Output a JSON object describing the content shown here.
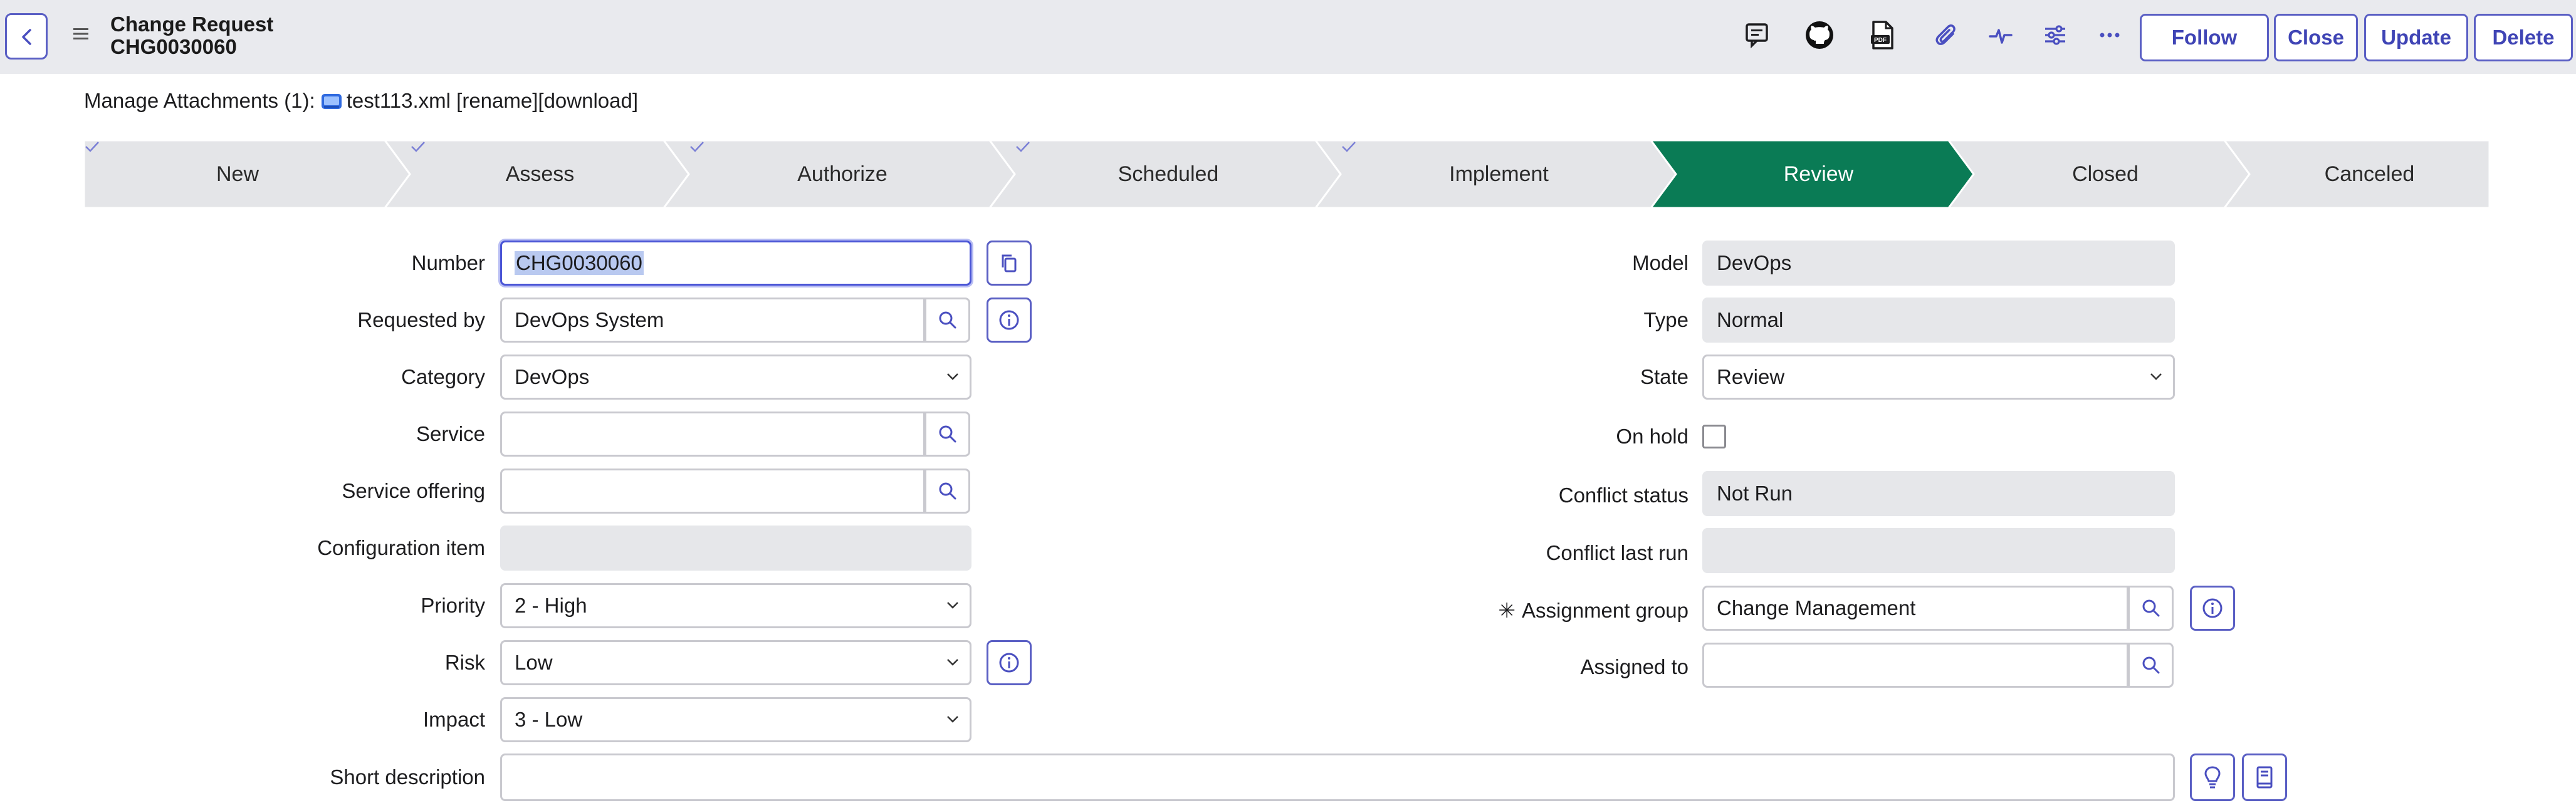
{
  "header": {
    "title": "Change Request",
    "number": "CHG0030060",
    "buttons": {
      "follow": "Follow",
      "close": "Close",
      "update": "Update",
      "delete": "Delete"
    }
  },
  "attachments": {
    "label": "Manage Attachments (1):",
    "filename": "test113.xml",
    "rename": "[rename]",
    "download": "[download]"
  },
  "flow": {
    "stages": [
      {
        "label": "New",
        "done": true
      },
      {
        "label": "Assess",
        "done": true
      },
      {
        "label": "Authorize",
        "done": true
      },
      {
        "label": "Scheduled",
        "done": true
      },
      {
        "label": "Implement",
        "done": true
      },
      {
        "label": "Review",
        "active": true
      },
      {
        "label": "Closed"
      },
      {
        "label": "Canceled"
      }
    ],
    "colors": {
      "inactive": "#e4e5e8",
      "active": "#0a7b55",
      "check": "#7a7fd6"
    }
  },
  "form": {
    "left": {
      "number": {
        "label": "Number",
        "value": "CHG0030060"
      },
      "requested_by": {
        "label": "Requested by",
        "value": "DevOps System"
      },
      "category": {
        "label": "Category",
        "value": "DevOps"
      },
      "service": {
        "label": "Service",
        "value": ""
      },
      "service_offering": {
        "label": "Service offering",
        "value": ""
      },
      "configuration_item": {
        "label": "Configuration item",
        "value": ""
      },
      "priority": {
        "label": "Priority",
        "value": "2 - High"
      },
      "risk": {
        "label": "Risk",
        "value": "Low"
      },
      "impact": {
        "label": "Impact",
        "value": "3 - Low"
      },
      "short_description": {
        "label": "Short description",
        "value": ""
      }
    },
    "right": {
      "model": {
        "label": "Model",
        "value": "DevOps"
      },
      "type": {
        "label": "Type",
        "value": "Normal"
      },
      "state": {
        "label": "State",
        "value": "Review"
      },
      "on_hold": {
        "label": "On hold",
        "checked": false
      },
      "conflict_status": {
        "label": "Conflict status",
        "value": "Not Run"
      },
      "conflict_last_run": {
        "label": "Conflict last run",
        "value": ""
      },
      "assignment_group": {
        "label": "Assignment group",
        "value": "Change Management",
        "required_mark": "✳"
      },
      "assigned_to": {
        "label": "Assigned to",
        "value": ""
      }
    }
  }
}
